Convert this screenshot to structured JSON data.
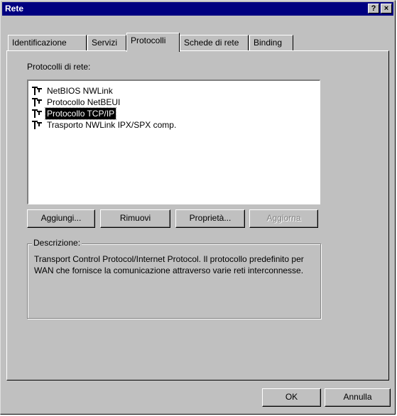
{
  "window": {
    "title": "Rete",
    "help_label": "?",
    "close_label": "×"
  },
  "tabs": [
    {
      "label": "Identificazione"
    },
    {
      "label": "Servizi"
    },
    {
      "label": "Protocolli",
      "active": true
    },
    {
      "label": "Schede di rete"
    },
    {
      "label": "Binding"
    }
  ],
  "protocols": {
    "label": "Protocolli di rete:",
    "items": [
      {
        "label": "NetBIOS NWLink",
        "icon": "network-protocol-icon"
      },
      {
        "label": "Protocollo NetBEUI",
        "icon": "network-protocol-icon"
      },
      {
        "label": "Protocollo TCP/IP",
        "icon": "network-protocol-icon",
        "selected": true
      },
      {
        "label": "Trasporto NWLink IPX/SPX comp.",
        "icon": "network-protocol-icon"
      }
    ]
  },
  "actions": {
    "add": "Aggiungi...",
    "remove": "Rimuovi",
    "properties": "Proprietà...",
    "update": "Aggiorna"
  },
  "description": {
    "title": "Descrizione:",
    "text": "Transport Control Protocol/Internet Protocol. Il protocollo predefinito per WAN che fornisce la comunicazione attraverso varie reti interconnesse."
  },
  "footer": {
    "ok": "OK",
    "cancel": "Annulla"
  }
}
